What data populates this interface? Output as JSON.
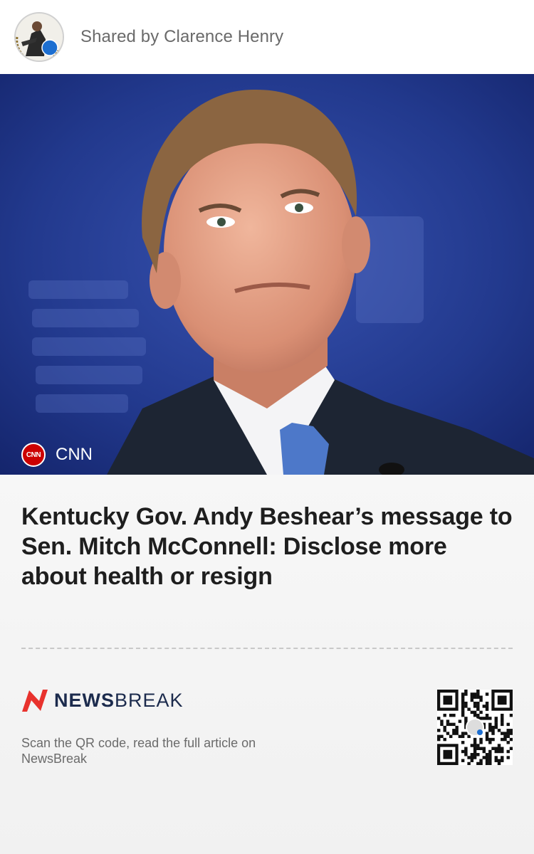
{
  "header": {
    "shared_by": "Shared by Clarence Henry",
    "avatar_icon": "profile-avatar"
  },
  "hero": {
    "image_description_icon": "news-photo",
    "source": {
      "logo_text": "CNN",
      "name": "CNN",
      "logo_color": "#cc0000"
    }
  },
  "article": {
    "headline": "Kentucky Gov. Andy Beshear’s message to Sen. Mitch McConnell: Disclose more about health or resign"
  },
  "footer": {
    "brand_bold": "NEWS",
    "brand_light": "BREAK",
    "brand_color": "#e8322d",
    "scan_text": "Scan the QR code, read the full article on NewsBreak",
    "qr_icon": "qr-code"
  }
}
